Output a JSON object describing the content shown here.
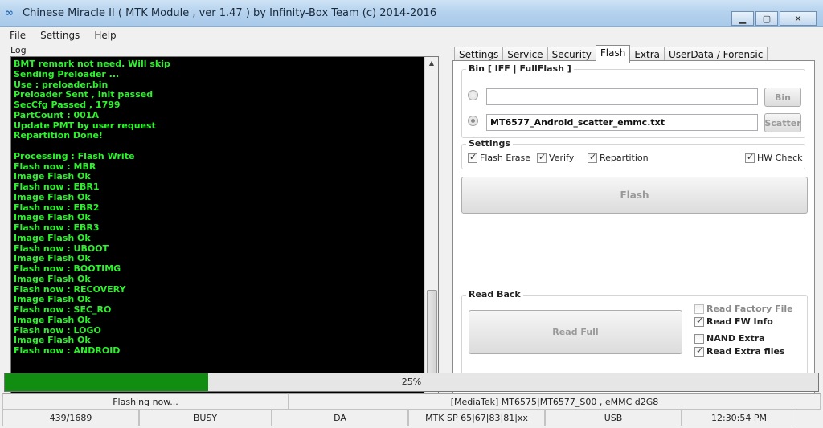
{
  "window": {
    "title": "Chinese Miracle II ( MTK Module , ver 1.47 ) by Infinity-Box Team (c) 2014-2016"
  },
  "menu": [
    "File",
    "Settings",
    "Help"
  ],
  "log": {
    "label": "Log",
    "lines": [
      "BMT remark not need. Will skip",
      "Sending Preloader ...",
      "Use : preloader.bin",
      "Preloader Sent , Init passed",
      "SecCfg Passed , 1799",
      "PartCount : 001A",
      "Update PMT by user request",
      "Repartition Done!",
      "",
      "Processing : Flash Write",
      "Flash now : MBR",
      "Image Flash Ok",
      "Flash now : EBR1",
      "Image Flash Ok",
      "Flash now : EBR2",
      "Image Flash Ok",
      "Flash now : EBR3",
      "Image Flash Ok",
      "Flash now : UBOOT",
      "Image Flash Ok",
      "Flash now : BOOTIMG",
      "Image Flash Ok",
      "Flash now : RECOVERY",
      "Image Flash Ok",
      "Flash now : SEC_RO",
      "Image Flash Ok",
      "Flash now : LOGO",
      "Image Flash Ok",
      "Flash now : ANDROID"
    ]
  },
  "tabs": [
    "Settings",
    "Service",
    "Security",
    "Flash",
    "Extra",
    "UserData / Forensic"
  ],
  "active_tab": "Flash",
  "flash": {
    "bin_group_label": "Bin  [ IFF | FullFlash ]",
    "bin_path": "",
    "bin_button": "Bin",
    "scatter_path": "MT6577_Android_scatter_emmc.txt",
    "scatter_button": "Scatter",
    "settings_label": "Settings",
    "options": [
      {
        "label": "Flash Erase",
        "checked": true
      },
      {
        "label": "Verify",
        "checked": true
      },
      {
        "label": "Repartition",
        "checked": true
      },
      {
        "label": "HW Check",
        "checked": true
      }
    ],
    "flash_button": "Flash",
    "readback_label": "Read Back",
    "read_full_button": "Read Full",
    "read_options": [
      {
        "label": "Read Factory File",
        "checked": false,
        "enabled": false
      },
      {
        "label": "Read FW Info",
        "checked": true,
        "enabled": true
      },
      {
        "label": "NAND Extra",
        "checked": false,
        "enabled": true
      },
      {
        "label": "Read Extra files",
        "checked": true,
        "enabled": true
      }
    ]
  },
  "progress": {
    "value": 0.25,
    "label": "25%"
  },
  "status": {
    "message": "Flashing now...",
    "device": "[MediaTek] MT6575|MT6577_S00 , eMMC d2G8",
    "counter": "439/1689",
    "state": "BUSY",
    "mode": "DA",
    "protocol": "MTK SP 65|67|83|81|xx",
    "port": "USB",
    "time": "12:30:54 PM"
  },
  "colors": {
    "log_text": "#2ef12e",
    "log_bg": "#000000",
    "progress_fill": "#118d11"
  }
}
